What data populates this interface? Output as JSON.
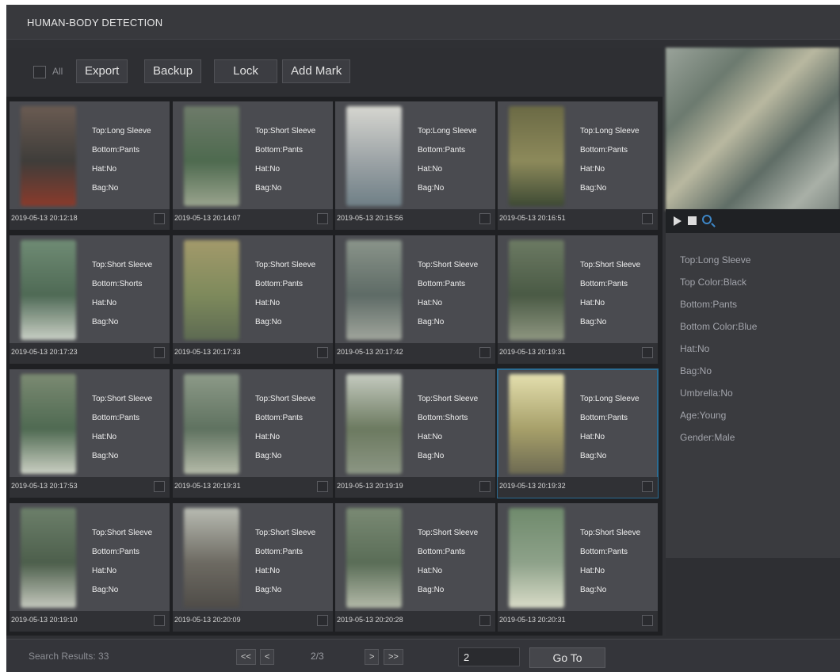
{
  "window": {
    "title": "HUMAN-BODY DETECTION"
  },
  "toolbar": {
    "all_label": "All",
    "export_label": "Export",
    "backup_label": "Backup",
    "lock_label": "Lock",
    "add_mark_label": "Add Mark"
  },
  "cards": [
    {
      "top": "Top:Long Sleeve",
      "bottom": "Bottom:Pants",
      "hat": "Hat:No",
      "bag": "Bag:No",
      "time": "2019-05-13 20:12:18",
      "thumb_colors": [
        "#6a5b52",
        "#3f3d3a",
        "#8a3b2c"
      ]
    },
    {
      "top": "Top:Short Sleeve",
      "bottom": "Bottom:Pants",
      "hat": "Hat:No",
      "bag": "Bag:No",
      "time": "2019-05-13 20:14:07",
      "thumb_colors": [
        "#6e7b6a",
        "#4e6a4f",
        "#9aa48e"
      ]
    },
    {
      "top": "Top:Long Sleeve",
      "bottom": "Bottom:Pants",
      "hat": "Hat:No",
      "bag": "Bag:No",
      "time": "2019-05-13 20:15:56",
      "thumb_colors": [
        "#d6d6d0",
        "#9ca3a6",
        "#6f7f86"
      ]
    },
    {
      "top": "Top:Long Sleeve",
      "bottom": "Bottom:Pants",
      "hat": "Hat:No",
      "bag": "Bag:No",
      "time": "2019-05-13 20:16:51",
      "thumb_colors": [
        "#6b6a45",
        "#8d8a5b",
        "#3e4a34"
      ]
    },
    {
      "top": "Top:Short Sleeve",
      "bottom": "Bottom:Shorts",
      "hat": "Hat:No",
      "bag": "Bag:No",
      "time": "2019-05-13 20:17:23",
      "thumb_colors": [
        "#6f8b74",
        "#4f6a55",
        "#c9cfc6"
      ]
    },
    {
      "top": "Top:Short Sleeve",
      "bottom": "Bottom:Pants",
      "hat": "Hat:No",
      "bag": "Bag:No",
      "time": "2019-05-13 20:17:33",
      "thumb_colors": [
        "#a39a6b",
        "#7e8a5c",
        "#5d6a52"
      ]
    },
    {
      "top": "Top:Short Sleeve",
      "bottom": "Bottom:Pants",
      "hat": "Hat:No",
      "bag": "Bag:No",
      "time": "2019-05-13 20:17:42",
      "thumb_colors": [
        "#8a948a",
        "#5e6b66",
        "#a0a59c"
      ]
    },
    {
      "top": "Top:Short Sleeve",
      "bottom": "Bottom:Pants",
      "hat": "Hat:No",
      "bag": "Bag:No",
      "time": "2019-05-13 20:19:31",
      "thumb_colors": [
        "#6c7a63",
        "#4a5a45",
        "#8e9680"
      ]
    },
    {
      "top": "Top:Short Sleeve",
      "bottom": "Bottom:Pants",
      "hat": "Hat:No",
      "bag": "Bag:No",
      "time": "2019-05-13 20:17:53",
      "thumb_colors": [
        "#7b8a72",
        "#4f6a52",
        "#cbd0c4"
      ]
    },
    {
      "top": "Top:Short Sleeve",
      "bottom": "Bottom:Pants",
      "hat": "Hat:No",
      "bag": "Bag:No",
      "time": "2019-05-13 20:19:31",
      "thumb_colors": [
        "#8d9a88",
        "#5f7260",
        "#b5bba9"
      ]
    },
    {
      "top": "Top:Short Sleeve",
      "bottom": "Bottom:Shorts",
      "hat": "Hat:No",
      "bag": "Bag:No",
      "time": "2019-05-13 20:19:19",
      "thumb_colors": [
        "#c5cbc0",
        "#6c7a60",
        "#8c9684"
      ]
    },
    {
      "top": "Top:Long Sleeve",
      "bottom": "Bottom:Pants",
      "hat": "Hat:No",
      "bag": "Bag:No",
      "time": "2019-05-13 20:19:32",
      "thumb_colors": [
        "#e4dfae",
        "#a7a06a",
        "#6d6a52"
      ],
      "selected": true
    },
    {
      "top": "Top:Short Sleeve",
      "bottom": "Bottom:Pants",
      "hat": "Hat:No",
      "bag": "Bag:No",
      "time": "2019-05-13 20:19:10",
      "thumb_colors": [
        "#6c7f6a",
        "#4d5f4c",
        "#c4c8bd"
      ]
    },
    {
      "top": "Top:Short Sleeve",
      "bottom": "Bottom:Pants",
      "hat": "Hat:No",
      "bag": "Bag:No",
      "time": "2019-05-13 20:20:09",
      "thumb_colors": [
        "#b8bbb2",
        "#6d6a62",
        "#4f4c48"
      ]
    },
    {
      "top": "Top:Short Sleeve",
      "bottom": "Bottom:Pants",
      "hat": "Hat:No",
      "bag": "Bag:No",
      "time": "2019-05-13 20:20:28",
      "thumb_colors": [
        "#7a8a74",
        "#5a6d57",
        "#b3b9a8"
      ]
    },
    {
      "top": "Top:Short Sleeve",
      "bottom": "Bottom:Pants",
      "hat": "Hat:No",
      "bag": "Bag:No",
      "time": "2019-05-13 20:20:31",
      "thumb_colors": [
        "#6f8a6c",
        "#8ea28a",
        "#d9dcc8"
      ]
    }
  ],
  "details": {
    "top": "Top:Long Sleeve",
    "top_color": "Top Color:Black",
    "bottom": "Bottom:Pants",
    "bottom_color": "Bottom Color:Blue",
    "hat": "Hat:No",
    "bag": "Bag:No",
    "umbrella": "Umbrella:No",
    "age": "Age:Young",
    "gender": "Gender:Male"
  },
  "footer": {
    "results": "Search Results: 33",
    "first": "<<",
    "prev": "<",
    "page": "2/3",
    "next": ">",
    "last": ">>",
    "page_input": "2",
    "goto_label": "Go To"
  },
  "colors": {
    "accent": "#3d86c6",
    "selection": "#2b6c93"
  }
}
